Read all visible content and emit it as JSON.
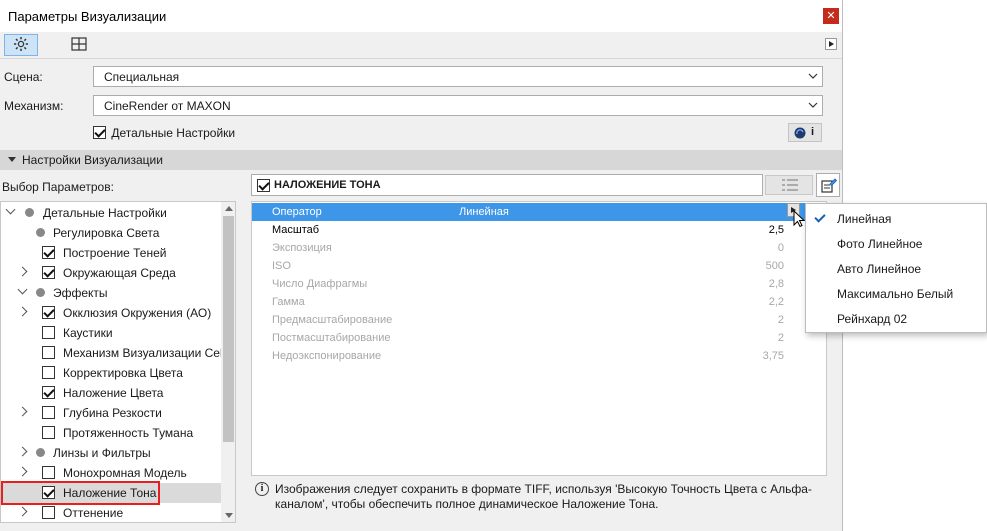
{
  "window": {
    "title": "Параметры Визуализации",
    "close_glyph": "✕"
  },
  "toolbar": {
    "icons": [
      "gear-icon",
      "grid-icon"
    ],
    "more_glyph": "▶"
  },
  "form": {
    "scene_label": "Сцена:",
    "scene_value": "Специальная",
    "engine_label": "Механизм:",
    "engine_value": "CineRender от MAXON",
    "detailed_settings_label": "Детальные Настройки",
    "detailed_settings_checked": true,
    "info_btn_glyph": "i"
  },
  "section": {
    "title": "Настройки Визуализации"
  },
  "params_label": "Выбор Параметров:",
  "tree": [
    {
      "label": "Детальные Настройки",
      "level": 0,
      "expander": "open",
      "marker": "dot"
    },
    {
      "label": "Регулировка Света",
      "level": 1,
      "expander": "none",
      "marker": "dot"
    },
    {
      "label": "Построение Теней",
      "level": 1,
      "expander": "none",
      "marker": "checked"
    },
    {
      "label": "Окружающая Среда",
      "level": 1,
      "expander": "closed",
      "marker": "checked"
    },
    {
      "label": "Эффекты",
      "level": 1,
      "expander": "open",
      "marker": "dot"
    },
    {
      "label": "Окклюзия Окружения (АО)",
      "level": 2,
      "expander": "closed",
      "marker": "checked"
    },
    {
      "label": "Каустики",
      "level": 2,
      "expander": "none",
      "marker": "unchecked"
    },
    {
      "label": "Механизм Визуализации Cel",
      "level": 2,
      "expander": "none",
      "marker": "unchecked"
    },
    {
      "label": "Корректировка Цвета",
      "level": 2,
      "expander": "none",
      "marker": "unchecked"
    },
    {
      "label": "Наложение Цвета",
      "level": 2,
      "expander": "none",
      "marker": "checked"
    },
    {
      "label": "Глубина Резкости",
      "level": 2,
      "expander": "closed",
      "marker": "unchecked"
    },
    {
      "label": "Протяженность Тумана",
      "level": 2,
      "expander": "none",
      "marker": "unchecked"
    },
    {
      "label": "Линзы и Фильтры",
      "level": 1,
      "expander": "closed",
      "marker": "dot"
    },
    {
      "label": "Монохромная Модель",
      "level": 2,
      "expander": "closed",
      "marker": "unchecked"
    },
    {
      "label": "Наложение Тона",
      "level": 2,
      "expander": "none",
      "marker": "checked",
      "selected": true
    },
    {
      "label": "Оттенение",
      "level": 2,
      "expander": "closed",
      "marker": "unchecked"
    }
  ],
  "panel": {
    "title": "НАЛОЖЕНИЕ ТОНА",
    "checked": true
  },
  "grid": [
    {
      "name": "Оператор",
      "value": "Линейная",
      "state": "selected"
    },
    {
      "name": "Масштаб",
      "value": "2,5",
      "state": "bold"
    },
    {
      "name": "Экспозиция",
      "value": "0",
      "state": "disabled"
    },
    {
      "name": "ISO",
      "value": "500",
      "state": "disabled"
    },
    {
      "name": "Число Диафрагмы",
      "value": "2,8",
      "state": "disabled"
    },
    {
      "name": "Гамма",
      "value": "2,2",
      "state": "disabled"
    },
    {
      "name": "Предмасштабирование",
      "value": "2",
      "state": "disabled"
    },
    {
      "name": "Постмасштабирование",
      "value": "2",
      "state": "disabled"
    },
    {
      "name": "Недоэкспонирование",
      "value": "3,75",
      "state": "disabled"
    }
  ],
  "info": {
    "icon_glyph": "i",
    "text": "Изображения следует сохранить в формате TIFF, используя 'Высокую Точность Цвета с Альфа-каналом', чтобы обеспечить полное динамическое Наложение Тона."
  },
  "popup": [
    {
      "label": "Линейная",
      "checked": true
    },
    {
      "label": "Фото Линейное",
      "checked": false
    },
    {
      "label": "Авто Линейное",
      "checked": false
    },
    {
      "label": "Максимально Белый",
      "checked": false
    },
    {
      "label": "Рейнхард 02",
      "checked": false
    }
  ],
  "colors": {
    "accent": "#3e96e8",
    "highlight_outline": "#e81f1f",
    "close": "#c42b1c"
  }
}
